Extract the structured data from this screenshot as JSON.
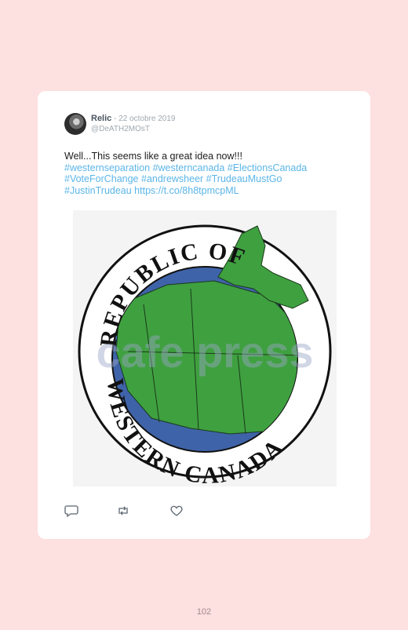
{
  "tweet": {
    "author_name": "Relic",
    "separator": " - ",
    "date": "22 octobre 2019",
    "handle": "@DeATH2MOsT",
    "body_text": "Well...This seems like a great idea now!!!",
    "hashtags_line1": "#westernseparation #westerncanada #ElectionsCanada",
    "hashtags_line2": "#VoteForChange #andrewsheer #TrudeauMustGo",
    "hashtags_line3": "#JustinTrudeau https://t.co/8h8tpmcpML"
  },
  "image": {
    "arc_top_text": "REPUBLIC OF",
    "arc_bottom_text": "WESTERN CANADA",
    "watermark": "cafe press",
    "colors": {
      "ocean": "#3f63a8",
      "land": "#3fa040",
      "ring": "#111111"
    }
  },
  "actions": {
    "reply_icon": "reply-icon",
    "retweet_icon": "retweet-icon",
    "like_icon": "heart-icon"
  },
  "page": {
    "number": "102"
  }
}
